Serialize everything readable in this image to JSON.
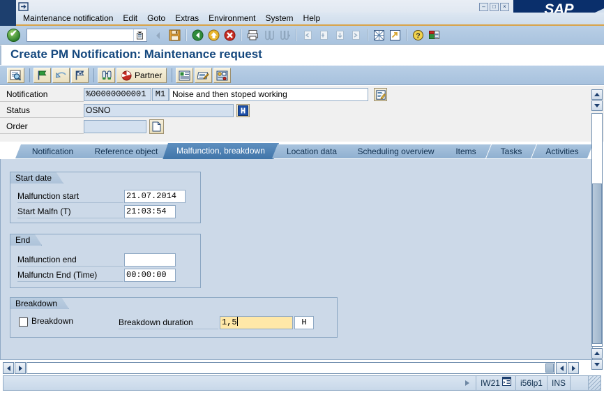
{
  "window": {
    "app_logo": "SAP",
    "window_icon": "sap-window-icon",
    "minimize": "–",
    "maximize": "□",
    "close": "×"
  },
  "menu": {
    "items": [
      {
        "label": "Maintenance notification",
        "accel": "M"
      },
      {
        "label": "Edit",
        "accel": "E"
      },
      {
        "label": "Goto",
        "accel": "G"
      },
      {
        "label": "Extras",
        "accel": "a"
      },
      {
        "label": "Environment",
        "accel": "n"
      },
      {
        "label": "System",
        "accel": "y"
      },
      {
        "label": "Help",
        "accel": "H"
      }
    ]
  },
  "system_toolbar": {
    "enter_icon": "green-check-enter-icon",
    "command_value": "",
    "command_placeholder": "",
    "dropdown_icon": "command-history-icon",
    "icons": [
      "back-arrow-icon",
      "save-icon",
      "back-green-icon",
      "exit-yellow-icon",
      "cancel-red-icon",
      "print-icon",
      "find-icon",
      "find-next-icon",
      "first-page-icon",
      "previous-page-icon",
      "next-page-icon",
      "last-page-icon",
      "create-session-icon",
      "create-shortcut-icon",
      "help-icon",
      "customize-layout-icon"
    ]
  },
  "page": {
    "title": "Create PM Notification: Maintenance request"
  },
  "app_toolbar": {
    "buttons": [
      {
        "name": "display-overview-button",
        "icon": "magnifier-list-icon",
        "label": ""
      },
      {
        "name": "put-in-process-button",
        "icon": "green-flag-icon",
        "label": ""
      },
      {
        "name": "postpone-button",
        "icon": "undo-flag-icon",
        "label": ""
      },
      {
        "name": "complete-button",
        "icon": "checkered-flag-icon",
        "label": ""
      },
      {
        "name": "object-information-button",
        "icon": "binoculars-icon",
        "label": ""
      },
      {
        "name": "partner-button",
        "icon": "partner-pie-icon",
        "label": "Partner"
      },
      {
        "name": "notification-long-text-button",
        "icon": "long-text-icon",
        "label": ""
      },
      {
        "name": "notification-list-button",
        "icon": "notepad-pen-icon",
        "label": ""
      },
      {
        "name": "document-flow-button",
        "icon": "action-box-icon",
        "label": ""
      }
    ]
  },
  "header": {
    "fields": [
      {
        "name": "notification",
        "label": "Notification",
        "number": "%00000000001",
        "type_code": "M1",
        "description": "Noise and then stoped working",
        "edit_icon": "long-text-edit-icon"
      },
      {
        "name": "status",
        "label": "Status",
        "value": "OSNO",
        "info_icon": "status-info-icon"
      },
      {
        "name": "order",
        "label": "Order",
        "value": "",
        "doc_icon": "create-order-icon"
      }
    ]
  },
  "tabs": [
    {
      "label": "Notification",
      "active": false
    },
    {
      "label": "Reference object",
      "active": false
    },
    {
      "label": "Malfunction, breakdown",
      "active": true
    },
    {
      "label": "Location data",
      "active": false
    },
    {
      "label": "Scheduling overview",
      "active": false
    },
    {
      "label": "Items",
      "active": false
    },
    {
      "label": "Tasks",
      "active": false
    },
    {
      "label": "Activities",
      "active": false
    }
  ],
  "groups": {
    "start_date": {
      "title": "Start date",
      "rows": [
        {
          "label": "Malfunction start",
          "value": "21.07.2014",
          "name": "malfunction-start"
        },
        {
          "label": "Start Malfn (T)",
          "value": "21:03:54",
          "name": "malfunction-start-time"
        }
      ]
    },
    "end": {
      "title": "End",
      "rows": [
        {
          "label": "Malfunction end",
          "value": "",
          "name": "malfunction-end"
        },
        {
          "label": "Malfunctn End (Time)",
          "value": "00:00:00",
          "name": "malfunction-end-time"
        }
      ]
    },
    "breakdown": {
      "title": "Breakdown",
      "checkbox_label": "Breakdown",
      "checkbox_checked": false,
      "duration_label": "Breakdown duration",
      "duration_value": "1,5",
      "duration_unit": "H"
    }
  },
  "status_bar": {
    "message": "",
    "expand_icon": "expand-message-icon",
    "transaction": "IW21",
    "session_icon": "session-info-icon",
    "system": "i56lp1",
    "mode": "INS",
    "empty_cell": "",
    "grip": "resize-grip"
  },
  "scrollbars": {
    "vertical_up": "scroll-up-icon",
    "vertical_down": "scroll-down-icon",
    "horizontal_left": "scroll-left-icon",
    "horizontal_right": "scroll-right-icon"
  },
  "colors": {
    "sap_blue": "#0a2f6b",
    "title_accent": "#15487e",
    "menu_rule": "#d8a348",
    "toolbar": "#b0c8e2",
    "content_bg": "#ccd9e8",
    "active_tab": "#3f74a8",
    "focus_field": "#ffe8a8",
    "readonly_field": "#d3e0ef"
  }
}
